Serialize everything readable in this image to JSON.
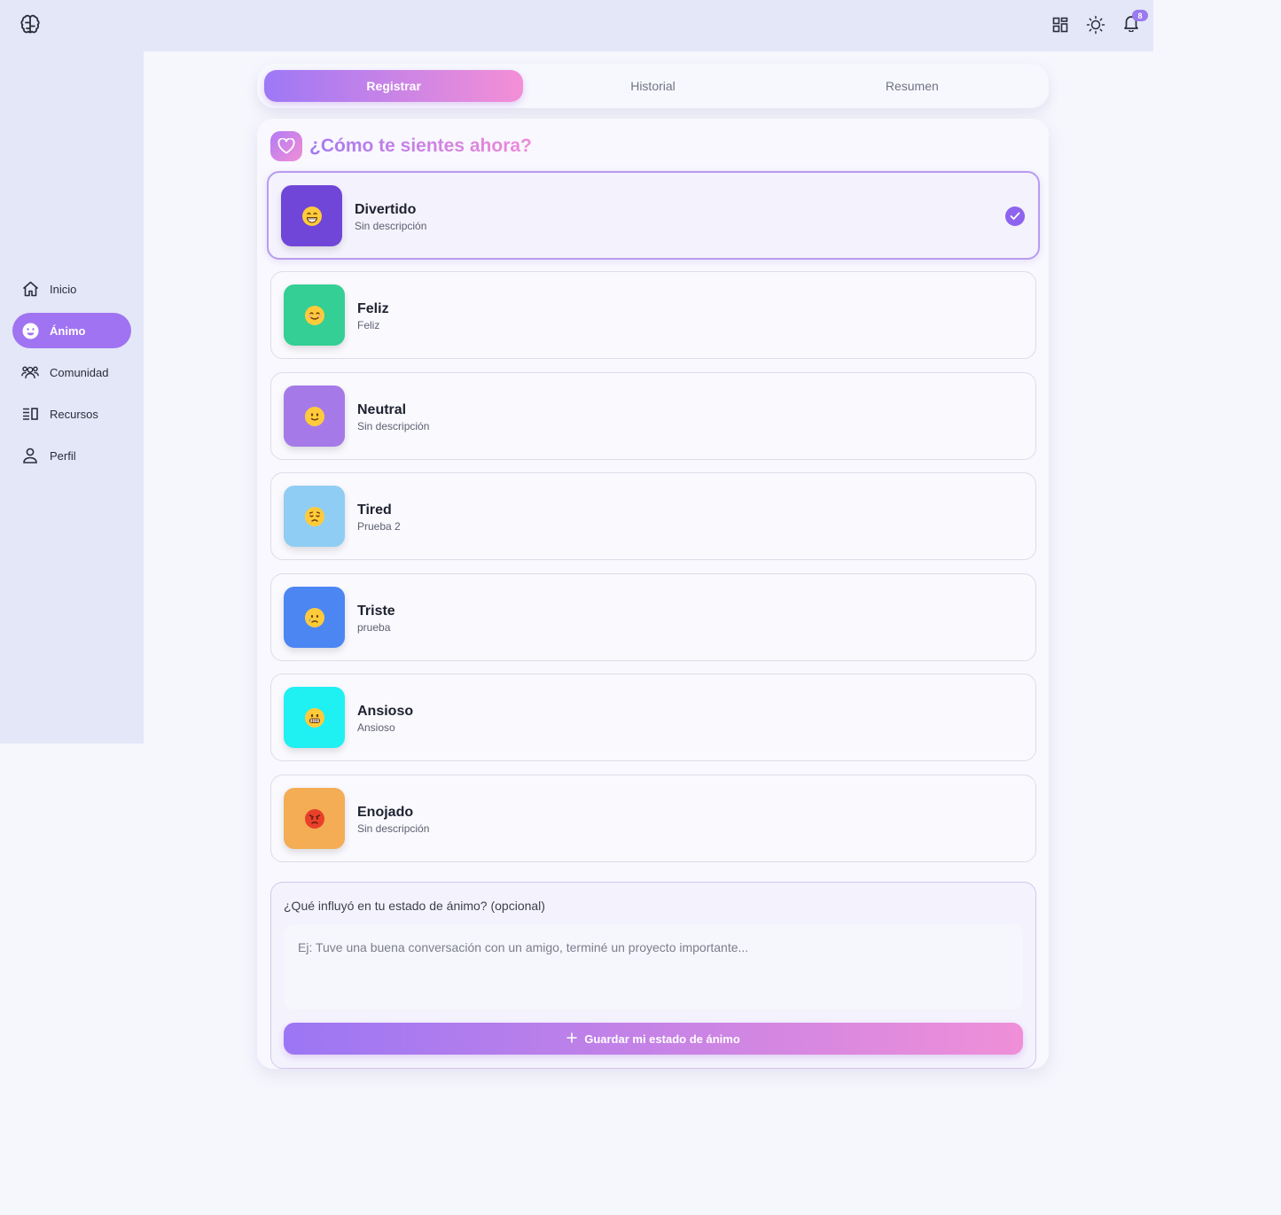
{
  "header": {
    "logo_icon": "brain-icon",
    "notification_count": "8",
    "icons": [
      "grid-icon",
      "sun-icon",
      "bell-icon"
    ]
  },
  "sidebar": {
    "items": [
      {
        "label": "Inicio",
        "icon": "home-icon"
      },
      {
        "label": "Ánimo",
        "icon": "smile-icon",
        "active": true
      },
      {
        "label": "Comunidad",
        "icon": "users-icon"
      },
      {
        "label": "Recursos",
        "icon": "list-icon"
      },
      {
        "label": "Perfil",
        "icon": "user-icon"
      }
    ]
  },
  "tabs": [
    {
      "label": "Registrar",
      "active": true
    },
    {
      "label": "Historial"
    },
    {
      "label": "Resumen"
    }
  ],
  "mood_card": {
    "heading": "¿Cómo te sientes ahora?",
    "moods": [
      {
        "name": "Divertido",
        "description": "Sin descripción",
        "color": "#7046d8",
        "emoji": "grinning-face",
        "selected": true
      },
      {
        "name": "Feliz",
        "description": "Feliz",
        "color": "#34cf94",
        "emoji": "smiling-face"
      },
      {
        "name": "Neutral",
        "description": "Sin descripción",
        "color": "#a57ae8",
        "emoji": "slightly-smiling-face"
      },
      {
        "name": "Tired",
        "description": "Prueba 2",
        "color": "#90cdf4",
        "emoji": "disappointed-face"
      },
      {
        "name": "Triste",
        "description": "prueba",
        "color": "#4c86f3",
        "emoji": "sad-tear-face"
      },
      {
        "name": "Ansioso",
        "description": "Ansioso",
        "color": "#1ff0f2",
        "emoji": "grimacing-face"
      },
      {
        "name": "Enojado",
        "description": "Sin descripción",
        "color": "#f4ad55",
        "emoji": "angry-face"
      }
    ],
    "influence": {
      "label": "¿Qué influyó en tu estado de ánimo? (opcional)",
      "placeholder": "Ej: Tuve una buena conversación con un amigo, terminé un proyecto importante...",
      "value": ""
    },
    "save_label": "Guardar mi estado de ánimo"
  },
  "colors": {
    "accent": "#a073f2",
    "gradient_start": "#9e78f6",
    "gradient_end": "#f48fd6",
    "sidebar_bg": "#e3e7f7",
    "page_bg": "#f6f6fd"
  }
}
